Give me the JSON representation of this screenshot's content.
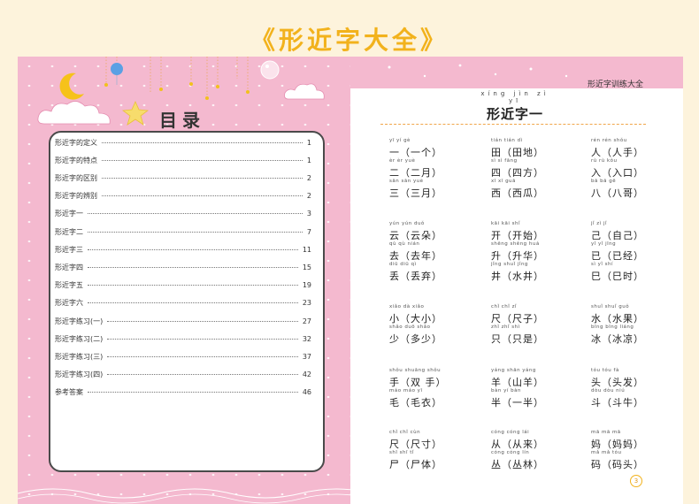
{
  "banner": {
    "title": "《形近字大全》"
  },
  "left_page": {
    "toc_heading": "目录",
    "toc": [
      {
        "label": "形近字的定义",
        "page": "1"
      },
      {
        "label": "形近字的特点",
        "page": "1"
      },
      {
        "label": "形近字的区别",
        "page": "2"
      },
      {
        "label": "形近字的辨别",
        "page": "2"
      },
      {
        "label": "形近字一",
        "page": "3"
      },
      {
        "label": "形近字二",
        "page": "7"
      },
      {
        "label": "形近字三",
        "page": "11"
      },
      {
        "label": "形近字四",
        "page": "15"
      },
      {
        "label": "形近字五",
        "page": "19"
      },
      {
        "label": "形近字六",
        "page": "23"
      },
      {
        "label": "形近字练习(一)",
        "page": "27"
      },
      {
        "label": "形近字练习(二)",
        "page": "32"
      },
      {
        "label": "形近字练习(三)",
        "page": "37"
      },
      {
        "label": "形近字练习(四)",
        "page": "42"
      },
      {
        "label": "参考答案",
        "page": "46"
      }
    ]
  },
  "right_page": {
    "running_head": "形近字训练大全",
    "section_pinyin": "xíng jìn zì yī",
    "section_title": "形近字一",
    "page_number": "3",
    "groups": [
      [
        {
          "py": "yī   yí   gè",
          "hz": "一（一个）"
        },
        {
          "py": "tián  tián  dì",
          "hz": "田（田地）"
        },
        {
          "py": "rén   rén  shǒu",
          "hz": "人（人手）"
        },
        {
          "py": "èr   èr   yuè",
          "hz": "二（二月）"
        },
        {
          "py": "sì   sì  fāng",
          "hz": "四（四方）"
        },
        {
          "py": "rù   rù   kǒu",
          "hz": "入（入口）"
        },
        {
          "py": "sān  sān  yuè",
          "hz": "三（三月）"
        },
        {
          "py": "xī   xī   guā",
          "hz": "西（西瓜）"
        },
        {
          "py": "bā   bā   gē",
          "hz": "八（八哥）"
        }
      ],
      [
        {
          "py": "yún  yún  duǒ",
          "hz": "云（云朵）"
        },
        {
          "py": "kāi  kāi  shǐ",
          "hz": "开（开始）"
        },
        {
          "py": "jǐ   zì   jǐ",
          "hz": "己（自己）"
        },
        {
          "py": "qù   qù  nián",
          "hz": "去（去年）"
        },
        {
          "py": "shēng shēng huá",
          "hz": "升（升华）"
        },
        {
          "py": "yǐ   yǐ  jīng",
          "hz": "已（已经）"
        },
        {
          "py": "diū  diū  qì",
          "hz": "丢（丢弃）"
        },
        {
          "py": "jǐng shuǐ jǐng",
          "hz": "井（水井）"
        },
        {
          "py": "sì   yǐ  shí",
          "hz": "巳（巳时）"
        }
      ],
      [
        {
          "py": "xiǎo dà  xiǎo",
          "hz": "小（大小）"
        },
        {
          "py": "chǐ  chǐ  zǐ",
          "hz": "尺（尺子）"
        },
        {
          "py": "shuǐ shuǐ guǒ",
          "hz": "水（水果）"
        },
        {
          "py": "shǎo duō shǎo",
          "hz": "少（多少）"
        },
        {
          "py": "zhǐ  zhǐ  shì",
          "hz": "只（只是）"
        },
        {
          "py": "bīng bīng liáng",
          "hz": "冰（冰凉）"
        }
      ],
      [
        {
          "py": "shǒu shuāng shǒu",
          "hz": "手（双 手）"
        },
        {
          "py": "yáng shān yáng",
          "hz": "羊（山羊）"
        },
        {
          "py": "tóu  tóu  fà",
          "hz": "头（头发）"
        },
        {
          "py": "máo  máo  yī",
          "hz": "毛（毛衣）"
        },
        {
          "py": "bàn  yí  bàn",
          "hz": "半（一半）"
        },
        {
          "py": "dòu  dòu  niú",
          "hz": "斗（斗牛）"
        }
      ],
      [
        {
          "py": "chǐ  chǐ  cùn",
          "hz": "尺（尺寸）"
        },
        {
          "py": "cóng cóng lái",
          "hz": "从（从来）"
        },
        {
          "py": "mā   mā  mā",
          "hz": "妈（妈妈）"
        },
        {
          "py": "shī  shī  tǐ",
          "hz": "尸（尸体）"
        },
        {
          "py": "cóng cóng lín",
          "hz": "丛（丛林）"
        },
        {
          "py": "mǎ   mǎ  tóu",
          "hz": "码（码头）"
        }
      ]
    ]
  }
}
